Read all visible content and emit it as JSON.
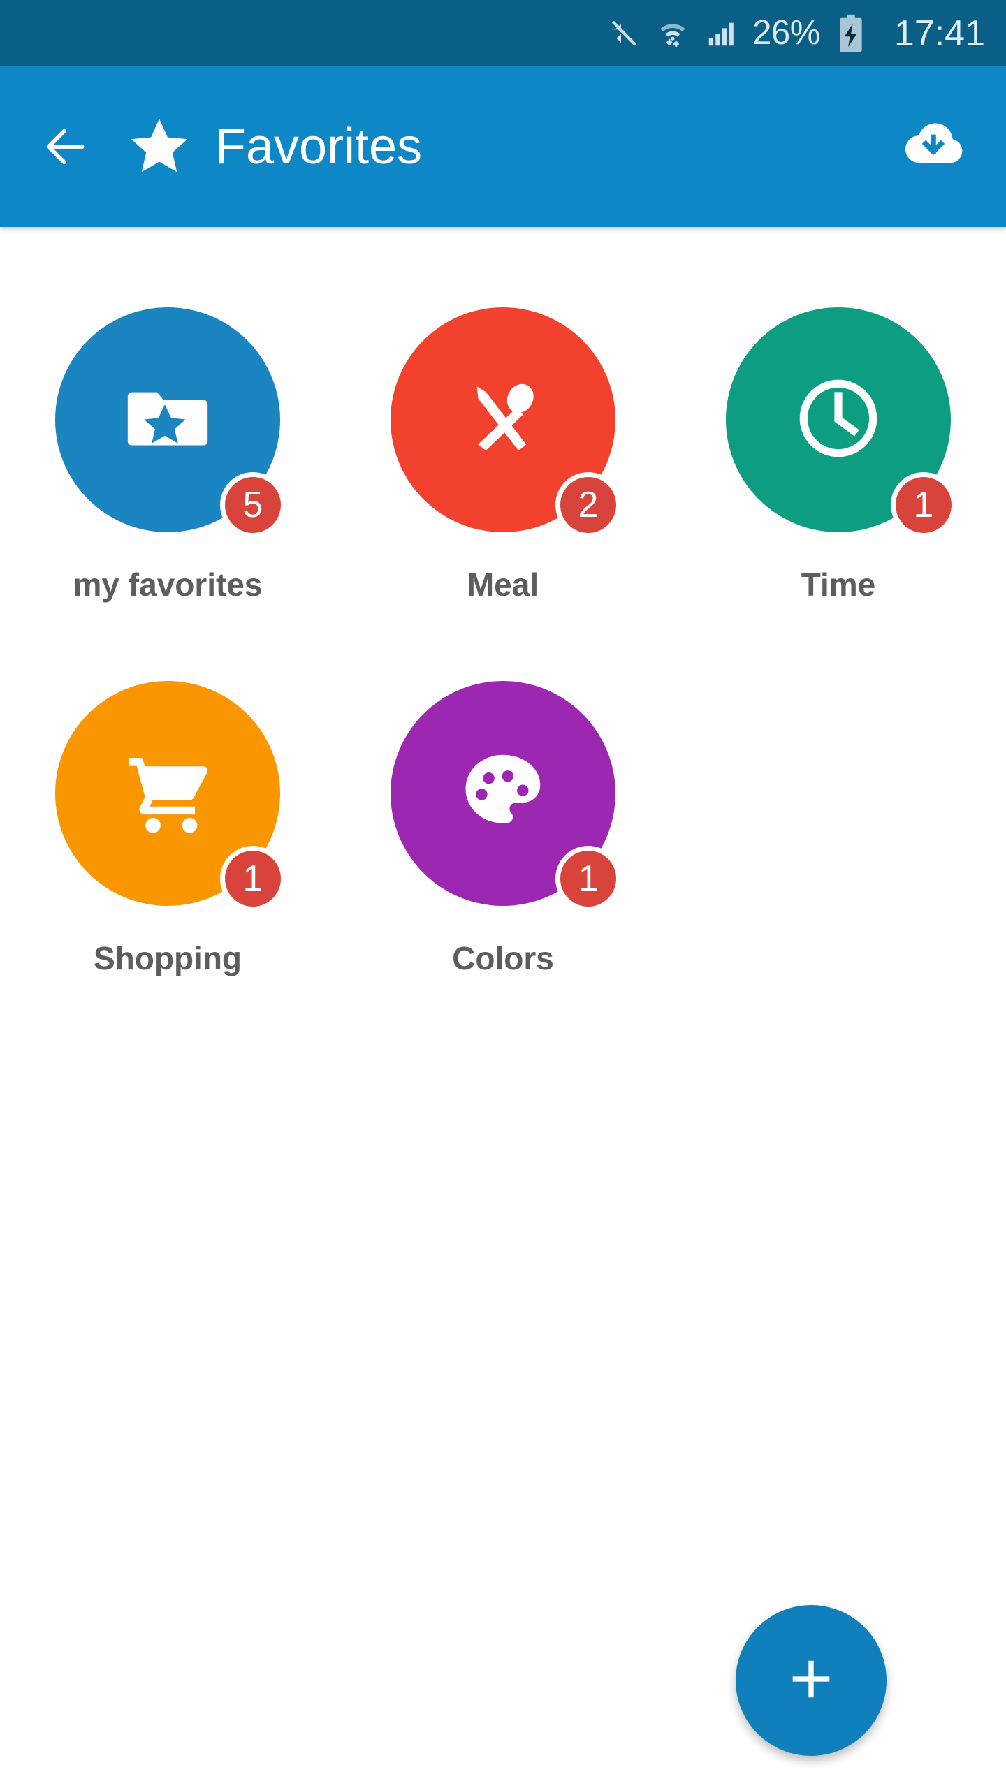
{
  "status_bar": {
    "background": "#0a5f87",
    "mute_icon": "mute-icon",
    "wifi_icon": "wifi-transfer-icon",
    "signal_icon": "cellular-signal-icon",
    "battery_percent": "26%",
    "battery_icon": "battery-charging-icon",
    "clock": "17:41"
  },
  "app_bar": {
    "background": "#0d87c6",
    "back_icon": "arrow-left-icon",
    "brand_icon": "star-icon",
    "title": "Favorites",
    "action_icon": "cloud-download-icon"
  },
  "content": {
    "background": "#ffffff",
    "items": [
      {
        "label": "my favorites",
        "badge": "5",
        "color": "#1a85c0",
        "icon": "folder-star-icon"
      },
      {
        "label": "Meal",
        "badge": "2",
        "color": "#f2422e",
        "icon": "fork-spoon-icon"
      },
      {
        "label": "Time",
        "badge": "1",
        "color": "#0d9e81",
        "icon": "clock-icon"
      },
      {
        "label": "Shopping",
        "badge": "1",
        "color": "#fa9600",
        "icon": "shopping-cart-icon"
      },
      {
        "label": "Colors",
        "badge": "1",
        "color": "#9c27b0",
        "icon": "palette-icon"
      }
    ],
    "badge_color": "#d8443c",
    "label_color": "#5d5d5d"
  },
  "fab": {
    "icon": "plus-icon",
    "color": "#1080bd"
  }
}
